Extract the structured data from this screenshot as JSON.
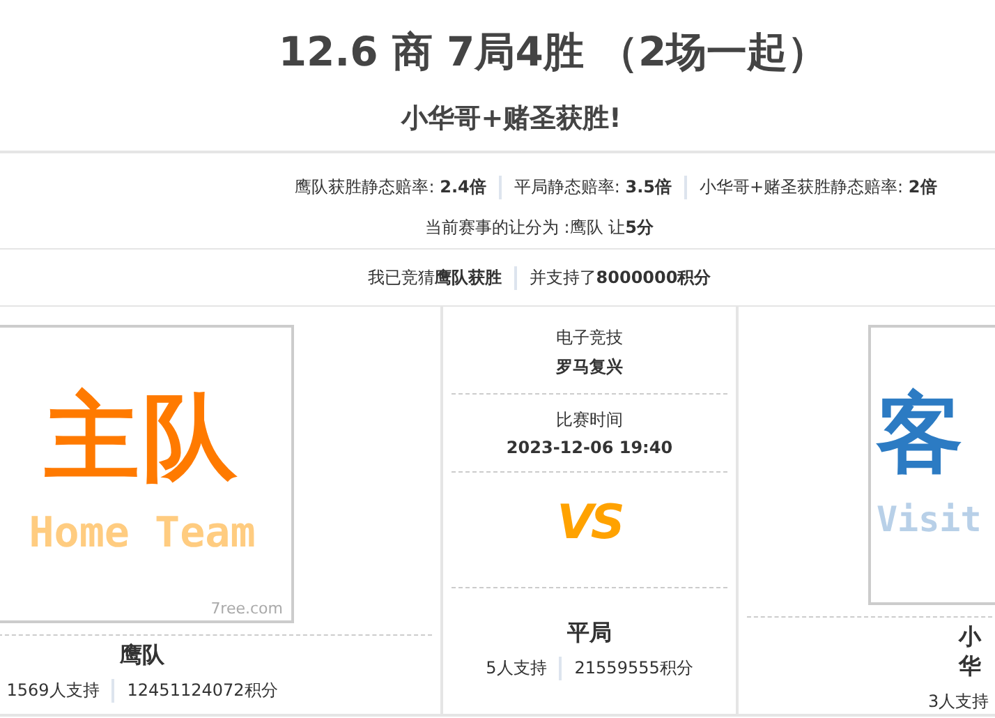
{
  "header": {
    "title": "12.6 商 7局4胜 （2场一起）",
    "subtitle": "小华哥+赌圣获胜!"
  },
  "odds": [
    "鹰队获胜静态赔率: **2.4倍**",
    "平局静态赔率: **3.5倍**",
    "小华哥+赌圣获胜静态赔率: **2倍**"
  ],
  "handicap": "当前赛事的让分为 :鹰队 让**5分**",
  "my_bet": [
    "我已竞猜**鹰队获胜**",
    "并支持了**8000000积分**"
  ],
  "home": {
    "logo": {
      "main": "主队",
      "sub": "Home Team",
      "credit": "7ree.com"
    },
    "name": "鹰队",
    "stats": [
      "1569人支持",
      "12451124072积分"
    ]
  },
  "center": {
    "category": "电子竞技",
    "match": "罗马复兴",
    "time_label": "比赛时间",
    "time": "2023-12-06 19:40",
    "vs": "VS",
    "draw": {
      "name": "平局",
      "stats": [
        "5人支持",
        "21559555积分"
      ]
    }
  },
  "away": {
    "logo": {
      "main": "客",
      "sub": "Visit"
    },
    "name": "小华",
    "stats": [
      "3人支持"
    ]
  }
}
